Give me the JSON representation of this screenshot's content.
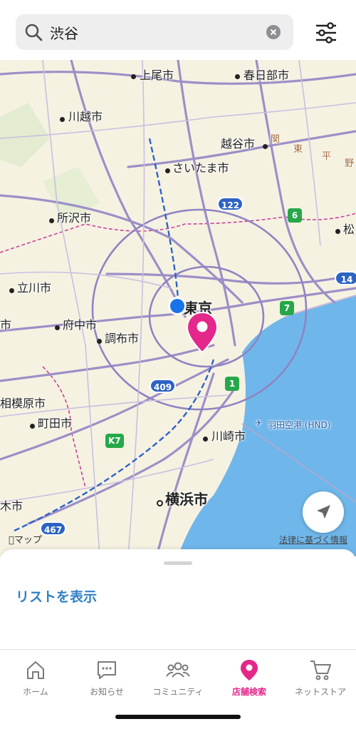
{
  "search": {
    "query": "渋谷",
    "icon": "search-icon",
    "clear_icon": "clear-icon"
  },
  "filter": {
    "icon": "sliders-icon"
  },
  "map": {
    "cities": {
      "ageo": "上尾市",
      "kasukabe": "春日部市",
      "kawagoe": "川越市",
      "koshigaya": "越谷市",
      "saitama": "さいたま市",
      "tokorozawa": "所沢市",
      "matsudo": "松",
      "tachikawa": "立川市",
      "tokyo": "東京",
      "fuchu": "府中市",
      "chofu": "調布市",
      "sagamihara": "相模原市",
      "machida": "町田市",
      "kawasaki": "川崎市",
      "yokohama": "横浜市",
      "atsugi": "木市",
      "hachioji_edge": "市"
    },
    "region_label": [
      "関",
      "東",
      "平",
      "野"
    ],
    "airport": "羽田空港 (HND)",
    "routes": [
      "122",
      "6",
      "14",
      "7",
      "1",
      "409",
      "K7",
      "467"
    ],
    "attribution": "法律に基づく情報",
    "provider": "マップ",
    "accent": "#e4278a",
    "user_dot_color": "#1a73e8"
  },
  "sheet": {
    "list_link": "リストを表示",
    "link_color": "#2f7fc8"
  },
  "tabs": [
    {
      "label": "ホーム",
      "icon": "home-icon"
    },
    {
      "label": "お知らせ",
      "icon": "chat-icon"
    },
    {
      "label": "コミュニティ",
      "icon": "community-icon"
    },
    {
      "label": "店舗検索",
      "icon": "location-pin-icon",
      "active": true
    },
    {
      "label": "ネットストア",
      "icon": "cart-icon"
    }
  ]
}
